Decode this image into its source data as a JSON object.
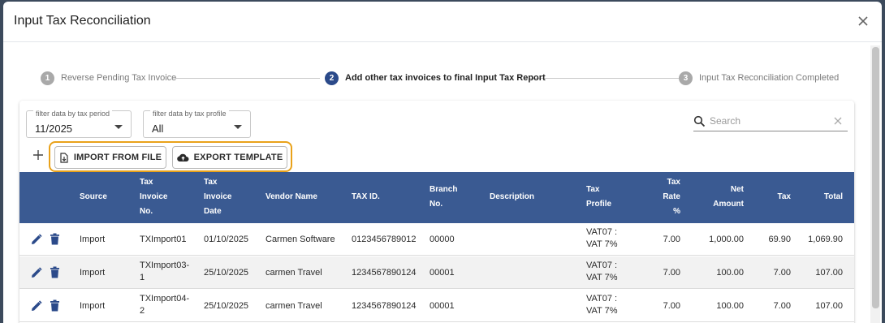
{
  "dialog": {
    "title": "Input Tax Reconciliation"
  },
  "stepper": [
    {
      "number": "1",
      "label": "Reverse Pending Tax Invoice",
      "active": false
    },
    {
      "number": "2",
      "label": "Add other tax invoices to final Input Tax Report",
      "active": true
    },
    {
      "number": "3",
      "label": "Input Tax Reconciliation Completed",
      "active": false
    }
  ],
  "filters": {
    "period": {
      "label": "filter data by tax period",
      "value": "11/2025"
    },
    "profile": {
      "label": "filter data by tax profile",
      "value": "All"
    }
  },
  "search": {
    "placeholder": "Search"
  },
  "actions": {
    "import_label": "IMPORT FROM FILE",
    "export_label": "EXPORT TEMPLATE"
  },
  "colors": {
    "accent": "#2b4a8a",
    "table_header": "#3a5a92",
    "highlight": "#e9a21a"
  },
  "table": {
    "columns": [
      "Source",
      "Tax\nInvoice\nNo.",
      "Tax\nInvoice\nDate",
      "Vendor Name",
      "TAX ID.",
      "Branch\nNo.",
      "Description",
      "Tax\nProfile",
      "Tax\nRate\n%",
      "Net\nAmount",
      "Tax",
      "Total"
    ],
    "rows": [
      {
        "source": "Import",
        "invoice_no": "TXImport01",
        "date": "01/10/2025",
        "vendor": "Carmen Software",
        "tax_id": "0123456789012",
        "branch": "00000",
        "description": "",
        "profile": "VAT07 :\nVAT 7%",
        "rate": "7.00",
        "net": "1,000.00",
        "tax": "69.90",
        "total": "1,069.90"
      },
      {
        "source": "Import",
        "invoice_no": "TXImport03-\n1",
        "date": "25/10/2025",
        "vendor": "carmen Travel",
        "tax_id": "1234567890124",
        "branch": "00001",
        "description": "",
        "profile": "VAT07 :\nVAT 7%",
        "rate": "7.00",
        "net": "100.00",
        "tax": "7.00",
        "total": "107.00"
      },
      {
        "source": "Import",
        "invoice_no": "TXImport04-\n2",
        "date": "25/10/2025",
        "vendor": "carmen Travel",
        "tax_id": "1234567890124",
        "branch": "00001",
        "description": "",
        "profile": "VAT07 :\nVAT 7%",
        "rate": "7.00",
        "net": "100.00",
        "tax": "7.00",
        "total": "107.00"
      }
    ]
  }
}
